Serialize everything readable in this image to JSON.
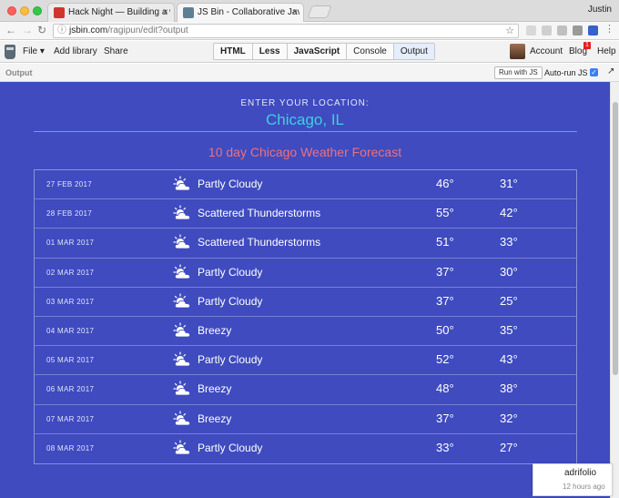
{
  "browser": {
    "tabs": [
      {
        "title": "Hack Night — Building a week",
        "favicon_color": "#d0342c"
      },
      {
        "title": "JS Bin - Collaborative JavaScr",
        "favicon_color": "#5f7f96"
      }
    ],
    "profile": "Justin",
    "url_host": "jsbin.com",
    "url_path": "/ragipun/edit?output"
  },
  "jsbin": {
    "menu": {
      "file": "File ▾",
      "add_library": "Add library",
      "share": "Share"
    },
    "panels": [
      "HTML",
      "Less",
      "JavaScript",
      "Console",
      "Output"
    ],
    "active_panel": "Output",
    "account": "Account",
    "blog": "Blog",
    "blog_badge": "1",
    "help": "Help",
    "output_label": "Output",
    "run_button": "Run with JS",
    "autorun_label": "Auto-run JS",
    "autorun_checked": true
  },
  "weather": {
    "prompt": "ENTER YOUR LOCATION:",
    "location": "Chicago, IL",
    "title": "10 day Chicago Weather Forecast",
    "rows": [
      {
        "date": "27 FEB 2017",
        "icon": "partly-cloudy-icon",
        "condition": "Partly Cloudy",
        "high": "46°",
        "low": "31°"
      },
      {
        "date": "28 FEB 2017",
        "icon": "partly-cloudy-icon",
        "condition": "Scattered Thunderstorms",
        "high": "55°",
        "low": "42°"
      },
      {
        "date": "01 MAR 2017",
        "icon": "partly-cloudy-icon",
        "condition": "Scattered Thunderstorms",
        "high": "51°",
        "low": "33°"
      },
      {
        "date": "02 MAR 2017",
        "icon": "partly-cloudy-icon",
        "condition": "Partly Cloudy",
        "high": "37°",
        "low": "30°"
      },
      {
        "date": "03 MAR 2017",
        "icon": "partly-cloudy-icon",
        "condition": "Partly Cloudy",
        "high": "37°",
        "low": "25°"
      },
      {
        "date": "04 MAR 2017",
        "icon": "partly-cloudy-icon",
        "condition": "Breezy",
        "high": "50°",
        "low": "35°"
      },
      {
        "date": "05 MAR 2017",
        "icon": "partly-cloudy-icon",
        "condition": "Partly Cloudy",
        "high": "52°",
        "low": "43°"
      },
      {
        "date": "06 MAR 2017",
        "icon": "partly-cloudy-icon",
        "condition": "Breezy",
        "high": "48°",
        "low": "38°"
      },
      {
        "date": "07 MAR 2017",
        "icon": "partly-cloudy-icon",
        "condition": "Breezy",
        "high": "37°",
        "low": "32°"
      },
      {
        "date": "08 MAR 2017",
        "icon": "partly-cloudy-icon",
        "condition": "Partly Cloudy",
        "high": "33°",
        "low": "27°"
      }
    ]
  },
  "toast": {
    "user": "adrifolio",
    "time": "12 hours ago"
  },
  "colors": {
    "background": "#3f4bbf",
    "location": "#3ed0df",
    "title": "#f0707a"
  }
}
